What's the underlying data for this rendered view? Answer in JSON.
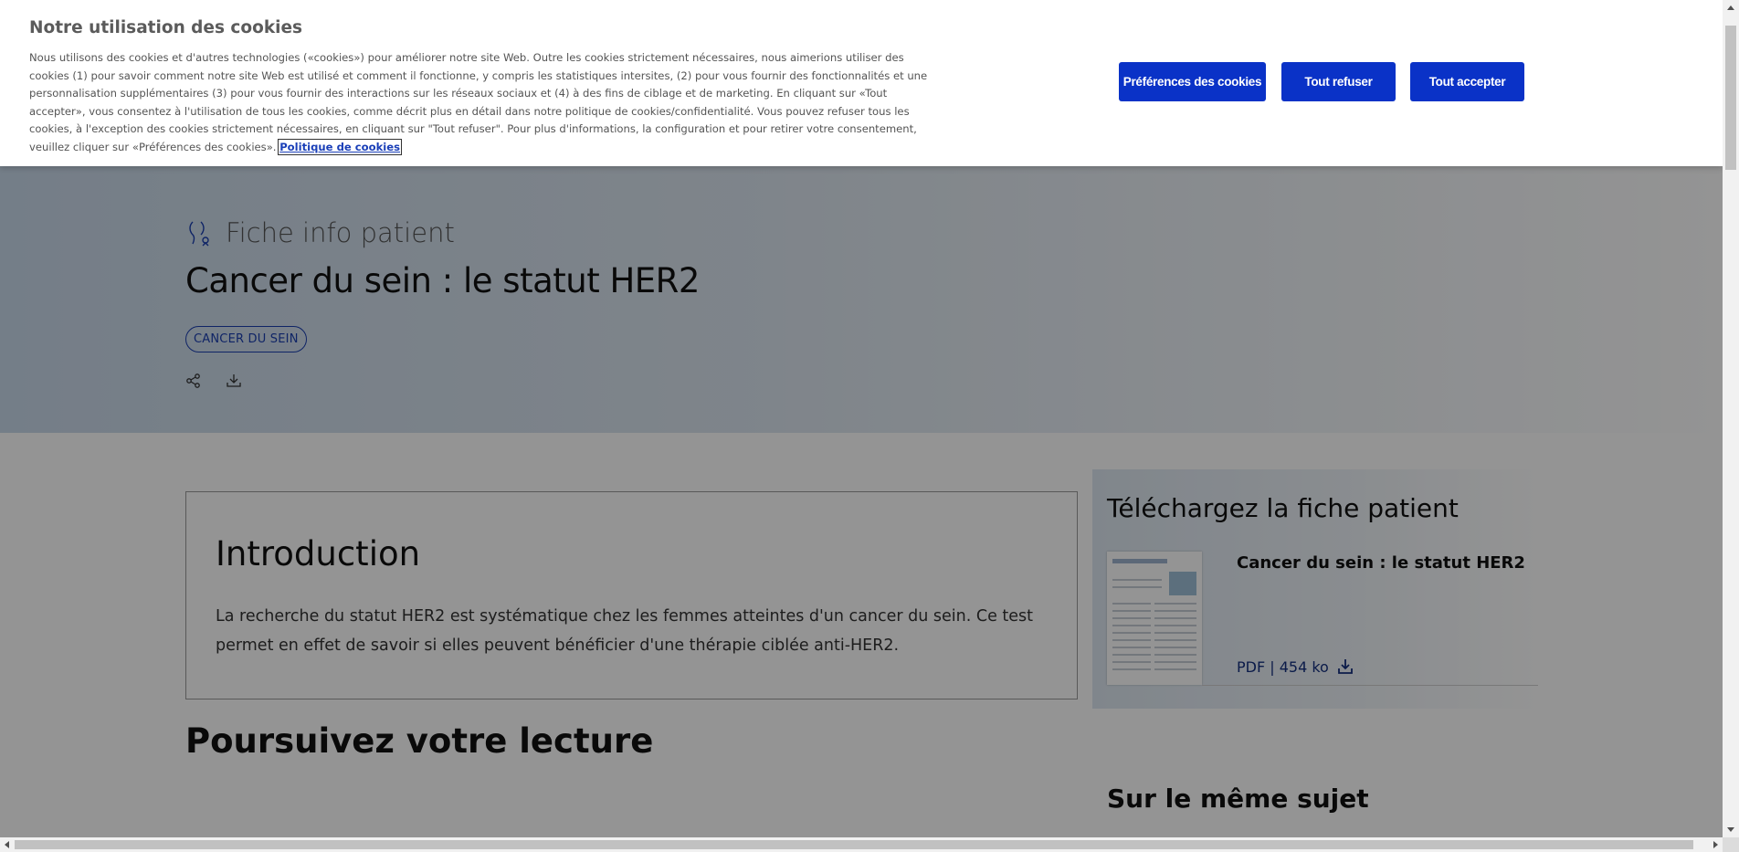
{
  "cookie_banner": {
    "title": "Notre utilisation des cookies",
    "body": "Nous utilisons des cookies et d'autres technologies («cookies») pour améliorer notre site Web. Outre les cookies strictement nécessaires, nous aimerions utiliser des cookies (1) pour savoir comment notre site Web est utilisé et comment il fonctionne, y compris les statistiques intersites, (2) pour vous fournir des fonctionnalités et une personnalisation supplémentaires (3) pour vous fournir des interactions sur les réseaux sociaux et (4) à des fins de ciblage et de marketing. En cliquant sur «Tout accepter», vous consentez à l'utilisation de tous les cookies, comme décrit plus en détail dans notre politique de cookies/confidentialité. Vous pouvez refuser tous les cookies, à l'exception des cookies strictement nécessaires, en cliquant sur \"Tout refuser\". Pour plus d'informations, la configuration et pour retirer votre consentement, veuillez cliquer sur «Préférences des cookies».",
    "policy_link": "Politique de cookies",
    "buttons": {
      "preferences": "Préférences des cookies",
      "reject_all": "Tout refuser",
      "accept_all": "Tout accepter"
    },
    "button_color": "#0a32c7"
  },
  "hero": {
    "eyebrow": "Fiche info patient",
    "eyebrow_icon": "ribbon-person-icon",
    "title": "Cancer du sein : le statut HER2",
    "tag": "CANCER DU SEIN",
    "action_icons": [
      "share-icon",
      "download-icon"
    ]
  },
  "intro": {
    "title": "Introduction",
    "text": "La recherche du statut HER2 est systématique chez les femmes atteintes d'un cancer du sein. Ce test permet en effet de savoir si elles peuvent bénéficier d'une thérapie ciblée anti-HER2."
  },
  "continue_reading": {
    "title": "Poursuivez votre lecture"
  },
  "download_panel": {
    "heading": "Téléchargez la fiche patient",
    "doc_title": "Cancer du sein : le statut HER2",
    "meta": "PDF | 454 ko",
    "meta_icon": "download-icon"
  },
  "same_topic": {
    "title": "Sur le même sujet"
  },
  "colors": {
    "accent": "#1b3fb0",
    "link": "#14307f",
    "overlay": "rgba(0,0,0,0.42)"
  }
}
